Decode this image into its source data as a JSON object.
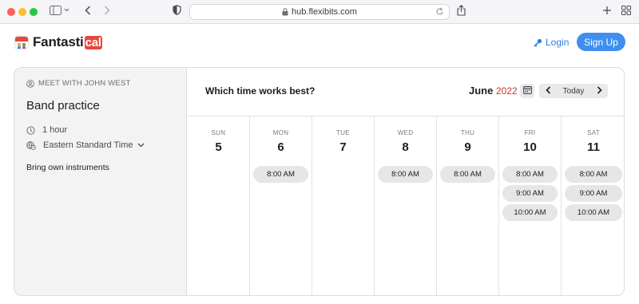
{
  "browser": {
    "url": "hub.flexibits.com"
  },
  "header": {
    "logo_text": "Fantasti",
    "logo_cal": "cal",
    "login_label": "Login",
    "signup_label": "Sign Up",
    "colors": {
      "accent": "#3f8ef0",
      "brand_red": "#e8473b"
    }
  },
  "event": {
    "meet_label": "MEET WITH JOHN WEST",
    "title": "Band practice",
    "duration": "1 hour",
    "timezone": "Eastern Standard Time",
    "description": "Bring own instruments"
  },
  "scheduler": {
    "question": "Which time works best?",
    "month": "June",
    "year": "2022",
    "today_label": "Today",
    "days": [
      {
        "dow": "SUN",
        "num": "5",
        "slots": []
      },
      {
        "dow": "MON",
        "num": "6",
        "slots": [
          "8:00 AM"
        ]
      },
      {
        "dow": "TUE",
        "num": "7",
        "slots": []
      },
      {
        "dow": "WED",
        "num": "8",
        "slots": [
          "8:00 AM"
        ]
      },
      {
        "dow": "THU",
        "num": "9",
        "slots": [
          "8:00 AM"
        ]
      },
      {
        "dow": "FRI",
        "num": "10",
        "slots": [
          "8:00 AM",
          "9:00 AM",
          "10:00 AM"
        ]
      },
      {
        "dow": "SAT",
        "num": "11",
        "slots": [
          "8:00 AM",
          "9:00 AM",
          "10:00 AM"
        ]
      }
    ]
  }
}
